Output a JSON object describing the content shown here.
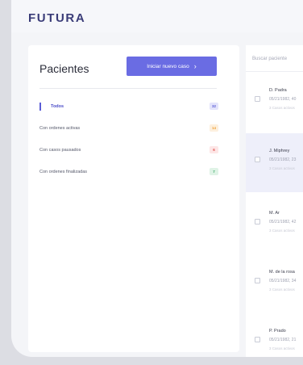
{
  "app": {
    "logo": "FUTURA"
  },
  "patients_panel": {
    "title": "Pacientes",
    "new_case_button": "Iniciar nuevo caso",
    "filters": [
      {
        "label": "Todos",
        "count": "32",
        "active": true,
        "badge_bg": "#e4e4fb",
        "badge_fg": "#5b5dd6"
      },
      {
        "label": "Con ordenes activas",
        "count": "14",
        "active": false,
        "badge_bg": "#fdf0de",
        "badge_fg": "#f0a23a"
      },
      {
        "label": "Con casos pausados",
        "count": "6",
        "active": false,
        "badge_bg": "#fde6e6",
        "badge_fg": "#e0504e"
      },
      {
        "label": "Con ordenes finalizadas",
        "count": "7",
        "active": false,
        "badge_bg": "#dff3e6",
        "badge_fg": "#3aa867"
      }
    ]
  },
  "patient_list": {
    "search_placeholder": "Buscar paciente",
    "items": [
      {
        "name": "D. Padra",
        "info": "05/21/1982, 40",
        "cases": "3 Casos activos",
        "selected": false
      },
      {
        "name": "J. Miphrey",
        "info": "05/21/1982, 23 ",
        "cases": "3 Casos activos",
        "selected": true
      },
      {
        "name": "M. Ar",
        "info": "05/21/1982, 42",
        "cases": "3 Casos activos",
        "selected": false
      },
      {
        "name": "M. de la rosa",
        "info": "05/21/1982, 34",
        "cases": "3 Casos activos",
        "selected": false
      },
      {
        "name": "P. Prado",
        "info": "05/21/1982, 21 ",
        "cases": "3 Casos activos",
        "selected": false
      }
    ]
  }
}
